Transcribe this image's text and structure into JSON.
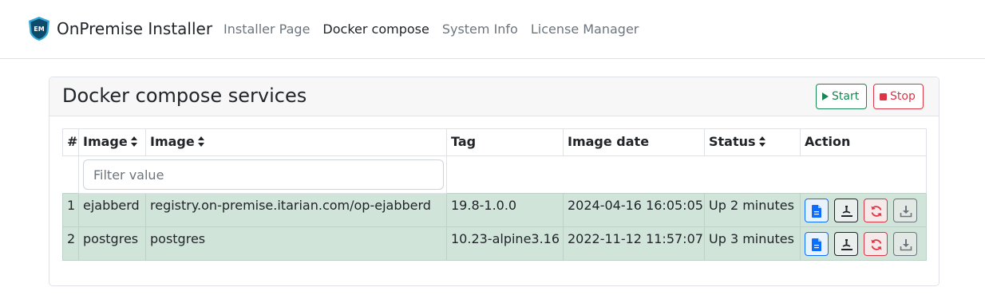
{
  "navbar": {
    "brand": {
      "logo_text": "EM",
      "title": "OnPremise Installer"
    },
    "items": [
      {
        "label": "Installer Page",
        "active": false
      },
      {
        "label": "Docker compose",
        "active": true
      },
      {
        "label": "System Info",
        "active": false
      },
      {
        "label": "License Manager",
        "active": false
      }
    ]
  },
  "card": {
    "title": "Docker compose services",
    "start_label": "Start",
    "stop_label": "Stop"
  },
  "table": {
    "columns": [
      "#",
      "Image",
      "Image",
      "Tag",
      "Image date",
      "Status",
      "Action"
    ],
    "filter_placeholder": "Filter value",
    "rows": [
      {
        "num": "1",
        "name": "ejabberd",
        "image": "registry.on-premise.itarian.com/op-ejabberd",
        "tag": "19.8-1.0.0",
        "date": "2024-04-16 16:05:05",
        "status": "Up 2 minutes"
      },
      {
        "num": "2",
        "name": "postgres",
        "image": "postgres",
        "tag": "10.23-alpine3.16",
        "date": "2022-11-12 11:57:07",
        "status": "Up 3 minutes"
      }
    ],
    "action_icons": [
      "file-icon",
      "inspect-icon",
      "restart-icon",
      "download-icon"
    ]
  },
  "colors": {
    "start": "#198754",
    "stop": "#dc3545",
    "row_background": "#d0e4da",
    "logo_shield": "#0e4a6a"
  }
}
